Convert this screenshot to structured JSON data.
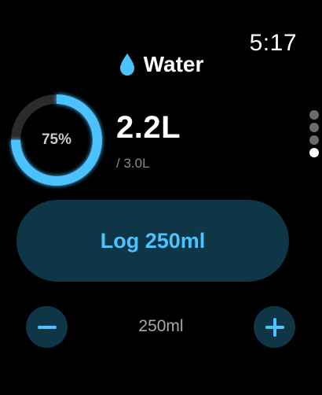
{
  "status_bar": {
    "time": "5:17"
  },
  "header": {
    "icon": "water-drop-icon",
    "title": "Water"
  },
  "progress": {
    "percent_label": "75%",
    "fraction": 0.75,
    "amount": "2.2L",
    "goal": "/ 3.0L"
  },
  "page_indicator": {
    "count": 4,
    "active_index": 3
  },
  "log_button": {
    "label": "Log 250ml"
  },
  "stepper": {
    "value": "250ml",
    "decrement_icon": "minus-icon",
    "increment_icon": "plus-icon"
  },
  "colors": {
    "accent": "#4cc2ff",
    "button_bg": "#0f3646",
    "ring_track": "#2b2b2b",
    "background": "#000000"
  }
}
